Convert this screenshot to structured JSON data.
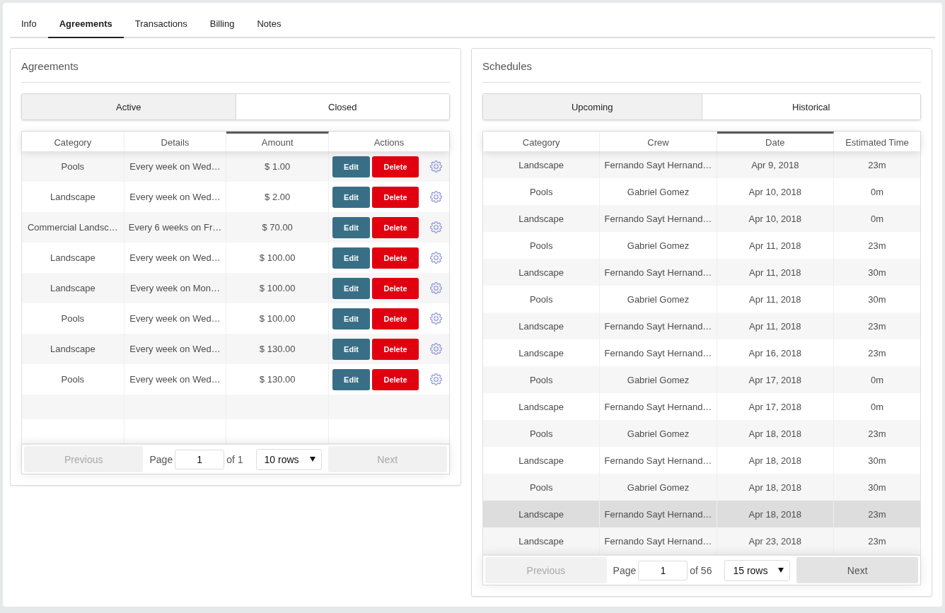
{
  "tabs": [
    {
      "label": "Info",
      "selected": false
    },
    {
      "label": "Agreements",
      "selected": true
    },
    {
      "label": "Transactions",
      "selected": false
    },
    {
      "label": "Billing",
      "selected": false
    },
    {
      "label": "Notes",
      "selected": false
    }
  ],
  "agreements": {
    "title": "Agreements",
    "filters": [
      {
        "label": "Active",
        "selected": true
      },
      {
        "label": "Closed",
        "selected": false
      }
    ],
    "table": {
      "columns": [
        {
          "label": "Category",
          "sorted": false
        },
        {
          "label": "Details",
          "sorted": false
        },
        {
          "label": "Amount",
          "sorted": true
        },
        {
          "label": "Actions",
          "sorted": false
        }
      ],
      "rows": [
        {
          "cells": [
            "Pools",
            "Every week on Wed…",
            "$ 1.00"
          ],
          "actions": [
            {
              "label": "Edit",
              "kind": "edit"
            },
            {
              "label": "Delete",
              "kind": "delete"
            }
          ]
        },
        {
          "cells": [
            "Landscape",
            "Every week on Wed…",
            "$ 2.00"
          ],
          "actions": [
            {
              "label": "Edit",
              "kind": "edit"
            },
            {
              "label": "Delete",
              "kind": "delete"
            }
          ]
        },
        {
          "cells": [
            "Commercial Landsc…",
            "Every 6 weeks on Fr…",
            "$ 70.00"
          ],
          "actions": [
            {
              "label": "Edit",
              "kind": "edit"
            },
            {
              "label": "Delete",
              "kind": "delete"
            }
          ]
        },
        {
          "cells": [
            "Landscape",
            "Every week on Wed…",
            "$ 100.00"
          ],
          "actions": [
            {
              "label": "Edit",
              "kind": "edit"
            },
            {
              "label": "Delete",
              "kind": "delete"
            }
          ]
        },
        {
          "cells": [
            "Landscape",
            "Every week on Mon…",
            "$ 100.00"
          ],
          "actions": [
            {
              "label": "Edit",
              "kind": "edit"
            },
            {
              "label": "Delete",
              "kind": "delete"
            }
          ]
        },
        {
          "cells": [
            "Pools",
            "Every week on Wed…",
            "$ 100.00"
          ],
          "actions": [
            {
              "label": "Edit",
              "kind": "edit"
            },
            {
              "label": "Delete",
              "kind": "delete"
            }
          ]
        },
        {
          "cells": [
            "Landscape",
            "Every week on Wed…",
            "$ 130.00"
          ],
          "actions": [
            {
              "label": "Edit",
              "kind": "edit"
            },
            {
              "label": "Delete",
              "kind": "delete"
            }
          ]
        },
        {
          "cells": [
            "Pools",
            "Every week on Wed…",
            "$ 130.00"
          ],
          "actions": [
            {
              "label": "Edit",
              "kind": "edit"
            },
            {
              "label": "Delete",
              "kind": "delete"
            }
          ]
        }
      ]
    },
    "pagination": {
      "previous": {
        "label": "Previous",
        "disabled": true
      },
      "page_label": "Page",
      "page": "1",
      "page_count": "of 1",
      "page_size": "10 rows",
      "next": {
        "label": "Next",
        "disabled": true
      }
    }
  },
  "schedules": {
    "title": "Schedules",
    "filters": [
      {
        "label": "Upcoming",
        "selected": true
      },
      {
        "label": "Historical",
        "selected": false
      }
    ],
    "table": {
      "columns": [
        {
          "label": "Category",
          "sorted": false
        },
        {
          "label": "Crew",
          "sorted": false
        },
        {
          "label": "Date",
          "sorted": true
        },
        {
          "label": "Estimated Time",
          "sorted": false
        }
      ],
      "rows": [
        {
          "cells": [
            "Landscape",
            "Fernando Sayt Hernand…",
            "Apr 9, 2018",
            "23m"
          ],
          "highlighted": false
        },
        {
          "cells": [
            "Pools",
            "Gabriel Gomez",
            "Apr 10, 2018",
            "0m"
          ],
          "highlighted": false
        },
        {
          "cells": [
            "Landscape",
            "Fernando Sayt Hernand…",
            "Apr 10, 2018",
            "0m"
          ],
          "highlighted": false
        },
        {
          "cells": [
            "Pools",
            "Gabriel Gomez",
            "Apr 11, 2018",
            "23m"
          ],
          "highlighted": false
        },
        {
          "cells": [
            "Landscape",
            "Fernando Sayt Hernand…",
            "Apr 11, 2018",
            "30m"
          ],
          "highlighted": false
        },
        {
          "cells": [
            "Pools",
            "Gabriel Gomez",
            "Apr 11, 2018",
            "30m"
          ],
          "highlighted": false
        },
        {
          "cells": [
            "Landscape",
            "Fernando Sayt Hernand…",
            "Apr 11, 2018",
            "23m"
          ],
          "highlighted": false
        },
        {
          "cells": [
            "Landscape",
            "Fernando Sayt Hernand…",
            "Apr 16, 2018",
            "23m"
          ],
          "highlighted": false
        },
        {
          "cells": [
            "Pools",
            "Gabriel Gomez",
            "Apr 17, 2018",
            "0m"
          ],
          "highlighted": false
        },
        {
          "cells": [
            "Landscape",
            "Fernando Sayt Hernand…",
            "Apr 17, 2018",
            "0m"
          ],
          "highlighted": false
        },
        {
          "cells": [
            "Pools",
            "Gabriel Gomez",
            "Apr 18, 2018",
            "23m"
          ],
          "highlighted": false
        },
        {
          "cells": [
            "Landscape",
            "Fernando Sayt Hernand…",
            "Apr 18, 2018",
            "30m"
          ],
          "highlighted": false
        },
        {
          "cells": [
            "Pools",
            "Gabriel Gomez",
            "Apr 18, 2018",
            "30m"
          ],
          "highlighted": false
        },
        {
          "cells": [
            "Landscape",
            "Fernando Sayt Hernand…",
            "Apr 18, 2018",
            "23m"
          ],
          "highlighted": true
        },
        {
          "cells": [
            "Landscape",
            "Fernando Sayt Hernand…",
            "Apr 23, 2018",
            "23m"
          ],
          "highlighted": false
        }
      ]
    },
    "pagination": {
      "previous": {
        "label": "Previous",
        "disabled": true
      },
      "page_label": "Page",
      "page": "1",
      "page_count": "of 56",
      "page_size": "15 rows",
      "next": {
        "label": "Next",
        "disabled": false
      }
    }
  }
}
